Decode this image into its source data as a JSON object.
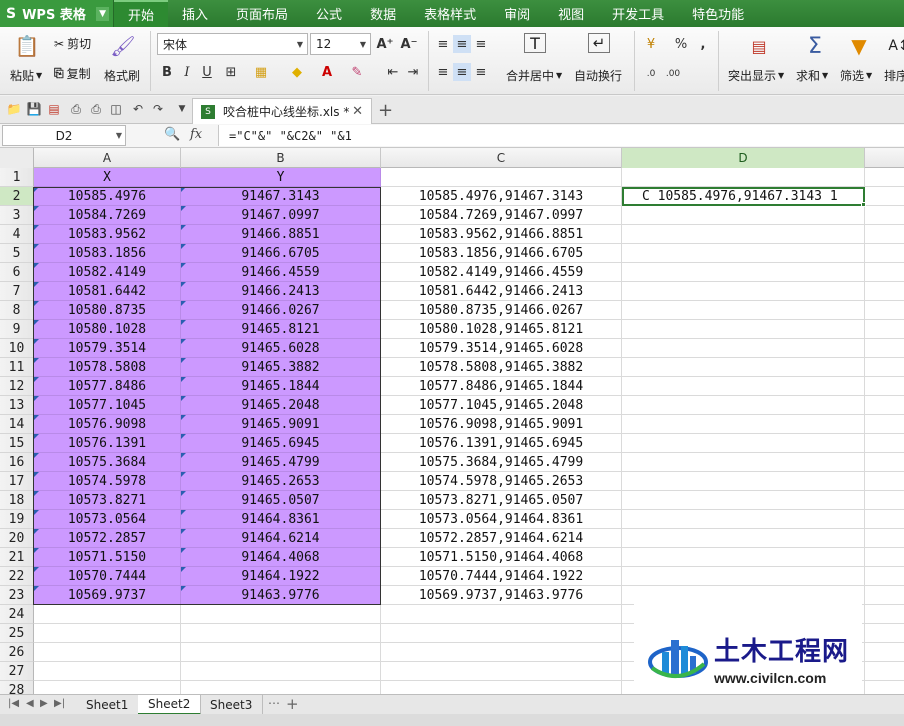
{
  "app": {
    "name": "WPS 表格",
    "logo_glyph": "S"
  },
  "menu": [
    "开始",
    "插入",
    "页面布局",
    "公式",
    "数据",
    "表格样式",
    "审阅",
    "视图",
    "开发工具",
    "特色功能"
  ],
  "ribbon": {
    "paste": "粘贴",
    "cut": "剪切",
    "copy": "复制",
    "format_painter": "格式刷",
    "font_name": "宋体",
    "font_size": "12",
    "merge_center": "合并居中",
    "wrap_text": "自动换行",
    "percent": "%",
    "comma": ",",
    "highlight": "突出显示",
    "sum": "求和",
    "filter": "筛选",
    "sort": "排序"
  },
  "document": {
    "tab_title": "咬合桩中心线坐标.xls *"
  },
  "formula_bar": {
    "cell_ref": "D2",
    "formula": "=\"C\"&\" \"&C2&\" \"&1",
    "fx": "fx"
  },
  "columns": [
    "A",
    "B",
    "C",
    "D"
  ],
  "rows": [
    {
      "n": "1",
      "a": "X",
      "b": "Y",
      "c": "",
      "d": ""
    },
    {
      "n": "2",
      "a": "10585.4976",
      "b": "91467.3143",
      "c": "10585.4976,91467.3143",
      "d": "C 10585.4976,91467.3143 1"
    },
    {
      "n": "3",
      "a": "10584.7269",
      "b": "91467.0997",
      "c": "10584.7269,91467.0997",
      "d": ""
    },
    {
      "n": "4",
      "a": "10583.9562",
      "b": "91466.8851",
      "c": "10583.9562,91466.8851",
      "d": ""
    },
    {
      "n": "5",
      "a": "10583.1856",
      "b": "91466.6705",
      "c": "10583.1856,91466.6705",
      "d": ""
    },
    {
      "n": "6",
      "a": "10582.4149",
      "b": "91466.4559",
      "c": "10582.4149,91466.4559",
      "d": ""
    },
    {
      "n": "7",
      "a": "10581.6442",
      "b": "91466.2413",
      "c": "10581.6442,91466.2413",
      "d": ""
    },
    {
      "n": "8",
      "a": "10580.8735",
      "b": "91466.0267",
      "c": "10580.8735,91466.0267",
      "d": ""
    },
    {
      "n": "9",
      "a": "10580.1028",
      "b": "91465.8121",
      "c": "10580.1028,91465.8121",
      "d": ""
    },
    {
      "n": "10",
      "a": "10579.3514",
      "b": "91465.6028",
      "c": "10579.3514,91465.6028",
      "d": ""
    },
    {
      "n": "11",
      "a": "10578.5808",
      "b": "91465.3882",
      "c": "10578.5808,91465.3882",
      "d": ""
    },
    {
      "n": "12",
      "a": "10577.8486",
      "b": "91465.1844",
      "c": "10577.8486,91465.1844",
      "d": ""
    },
    {
      "n": "13",
      "a": "10577.1045",
      "b": "91465.2048",
      "c": "10577.1045,91465.2048",
      "d": ""
    },
    {
      "n": "14",
      "a": "10576.9098",
      "b": "91465.9091",
      "c": "10576.9098,91465.9091",
      "d": ""
    },
    {
      "n": "15",
      "a": "10576.1391",
      "b": "91465.6945",
      "c": "10576.1391,91465.6945",
      "d": ""
    },
    {
      "n": "16",
      "a": "10575.3684",
      "b": "91465.4799",
      "c": "10575.3684,91465.4799",
      "d": ""
    },
    {
      "n": "17",
      "a": "10574.5978",
      "b": "91465.2653",
      "c": "10574.5978,91465.2653",
      "d": ""
    },
    {
      "n": "18",
      "a": "10573.8271",
      "b": "91465.0507",
      "c": "10573.8271,91465.0507",
      "d": ""
    },
    {
      "n": "19",
      "a": "10573.0564",
      "b": "91464.8361",
      "c": "10573.0564,91464.8361",
      "d": ""
    },
    {
      "n": "20",
      "a": "10572.2857",
      "b": "91464.6214",
      "c": "10572.2857,91464.6214",
      "d": ""
    },
    {
      "n": "21",
      "a": "10571.5150",
      "b": "91464.4068",
      "c": "10571.5150,91464.4068",
      "d": ""
    },
    {
      "n": "22",
      "a": "10570.7444",
      "b": "91464.1922",
      "c": "10570.7444,91464.1922",
      "d": ""
    },
    {
      "n": "23",
      "a": "10569.9737",
      "b": "91463.9776",
      "c": "10569.9737,91463.9776",
      "d": ""
    },
    {
      "n": "24",
      "a": "",
      "b": "",
      "c": "",
      "d": ""
    },
    {
      "n": "25",
      "a": "",
      "b": "",
      "c": "",
      "d": ""
    },
    {
      "n": "26",
      "a": "",
      "b": "",
      "c": "",
      "d": ""
    },
    {
      "n": "27",
      "a": "",
      "b": "",
      "c": "",
      "d": ""
    },
    {
      "n": "28",
      "a": "",
      "b": "",
      "c": "",
      "d": ""
    }
  ],
  "sheets": [
    "Sheet1",
    "Sheet2",
    "Sheet3"
  ],
  "active_sheet": "Sheet2",
  "watermark": {
    "title": "土木工程网",
    "url": "www.civilcn.com"
  },
  "colors": {
    "menu_green": "#2e7d32",
    "highlight_purple": "#cc99ff",
    "selection_green": "#2e7d32"
  }
}
